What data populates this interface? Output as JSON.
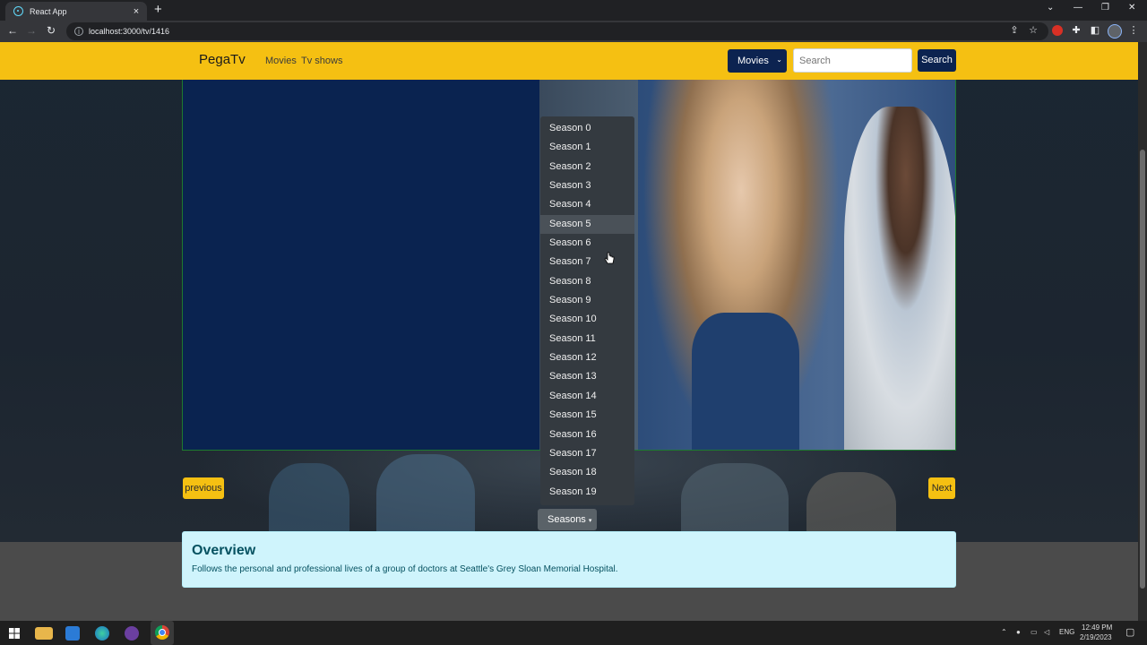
{
  "browser": {
    "tab_title": "React App",
    "tab_close": "×",
    "new_tab": "+",
    "url": "localhost:3000/tv/1416",
    "window_controls": [
      "⌄",
      "—",
      "❐",
      "✕"
    ],
    "nav_icons": [
      "←",
      "→",
      "↻"
    ]
  },
  "navbar": {
    "brand": "PegaTv",
    "links": [
      "Movies",
      "Tv shows"
    ],
    "category_select": "Movies",
    "search_placeholder": "Search",
    "search_button": "Search"
  },
  "player": {
    "left_color": "#0a2350"
  },
  "seasons_dropdown": {
    "items": [
      "Season 0",
      "Season 1",
      "Season 2",
      "Season 3",
      "Season 4",
      "Season 5",
      "Season 6",
      "Season 7",
      "Season 8",
      "Season 9",
      "Season 10",
      "Season 11",
      "Season 12",
      "Season 13",
      "Season 14",
      "Season 15",
      "Season 16",
      "Season 17",
      "Season 18",
      "Season 19"
    ],
    "hovered": "Season 5",
    "toggle_label": "Seasons"
  },
  "pager": {
    "previous": "previous",
    "next": "Next"
  },
  "overview": {
    "title": "Overview",
    "text": "Follows the personal and professional lives of a group of doctors at Seattle's Grey Sloan Memorial Hospital."
  },
  "taskbar": {
    "language": "ENG",
    "time": "12:49 PM",
    "date": "2/19/2023"
  },
  "colors": {
    "navbar": "#f5c012",
    "primary_dark": "#0c2350",
    "overview_bg": "#cff4fc"
  }
}
